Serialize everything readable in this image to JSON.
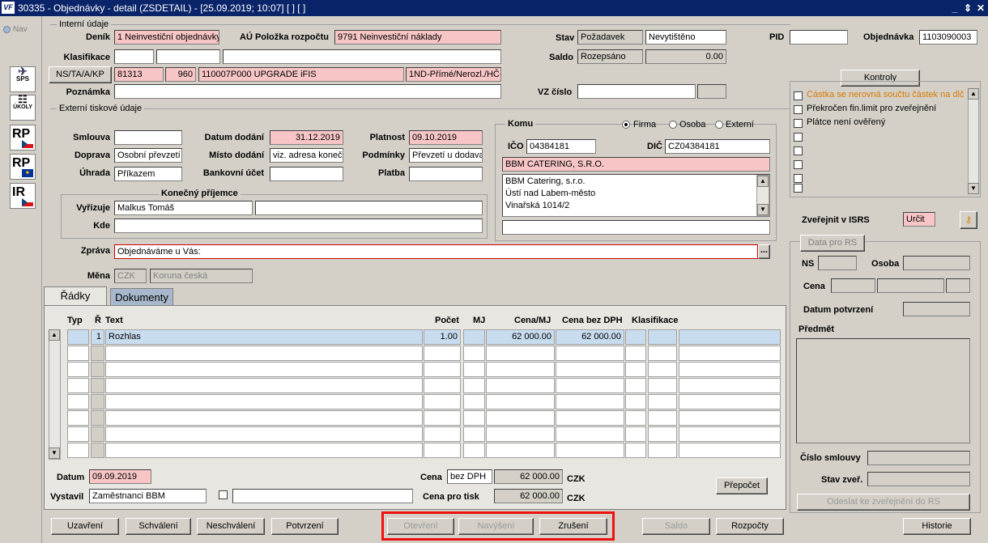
{
  "window": {
    "title": "30335 - Objednávky - detail (ZSDETAIL) - [25.09.2019; 10:07]  [ ]  [ ]",
    "logo": "VF",
    "buttons": [
      "_",
      "⇕",
      "✕"
    ]
  },
  "nav": {
    "label": "Nav"
  },
  "side": [
    {
      "label": "SPS"
    },
    {
      "label": "ÚKOLY"
    },
    {
      "label": "RP"
    },
    {
      "label": "RP"
    },
    {
      "label": "IR"
    }
  ],
  "interni": {
    "legend": "Interní údaje",
    "denik_label": "Deník",
    "denik": "1 Neinvestiční objednávky",
    "au_label": "AÚ Položka rozpočtu",
    "au": "9791 Neinvestiční náklady",
    "klasifikace_label": "Klasifikace",
    "ns_button": "NS/TA/A/KP",
    "ns1": "81313",
    "ns2": "960",
    "ns3": "110007P000 UPGRADE iFIS",
    "ns4": "1ND-Přímé/Nerozl./HČ-D",
    "poznamka_label": "Poznámka",
    "stav_label": "Stav",
    "stav1": "Požadavek",
    "stav2": "Nevytištěno",
    "saldo_label": "Saldo",
    "saldo1": "Rozepsáno",
    "saldo2": "0.00",
    "vz_label": "VZ číslo",
    "pid_label": "PID",
    "obj_label": "Objednávka",
    "obj": "1103090003"
  },
  "externi": {
    "legend": "Externí tiskové údaje",
    "smlouva_label": "Smlouva",
    "doprava_label": "Doprava",
    "doprava": "Osobní převzetí",
    "uhrada_label": "Úhrada",
    "uhrada": "Příkazem",
    "datum_dodani_label": "Datum dodání",
    "datum_dodani": "31.12.2019",
    "misto_label": "Místo dodání",
    "misto": "viz. adresa koneč",
    "bu_label": "Bankovní účet",
    "platnost_label": "Platnost",
    "platnost": "09.10.2019",
    "podminky_label": "Podmínky",
    "podminky": "Převzetí u dodava",
    "platba_label": "Platba"
  },
  "prijemce": {
    "legend": "Konečný příjemce",
    "vyrizuje_label": "Vyřizuje",
    "vyrizuje": "Malkus Tomáš",
    "kde_label": "Kde"
  },
  "zprava": {
    "label": "Zpráva",
    "value": "Objednáváme u Vás:",
    "more": "..."
  },
  "mena": {
    "label": "Měna",
    "code": "CZK",
    "name": "Koruna česká"
  },
  "komu": {
    "legend": "Komu",
    "radios": [
      "Firma",
      "Osoba",
      "Externí"
    ],
    "ico_label": "IČO",
    "ico": "04384181",
    "dic_label": "DIČ",
    "dic": "CZ04384181",
    "name": "BBM CATERING, S.R.O.",
    "address": [
      "BBM Catering, s.r.o.",
      "Ústí nad Labem-město",
      "Vinařská 1014/2"
    ]
  },
  "kontroly": {
    "button": "Kontroly",
    "items": [
      {
        "label": "Částka se nerovná součtu částek na dlč",
        "color": "#d97a00"
      },
      {
        "label": "Překročen fin.limit pro zveřejnění",
        "color": "#000000"
      },
      {
        "label": "Plátce není ověřený",
        "color": "#000000"
      }
    ]
  },
  "isrs": {
    "label": "Zveřejnit v ISRS",
    "value": "Určit"
  },
  "rs": {
    "button": "Data pro RS",
    "ns_label": "NS",
    "osoba_label": "Osoba",
    "cena_label": "Cena",
    "datum_label": "Datum potvrzení",
    "predmet_label": "Předmět",
    "cislo_label": "Číslo smlouvy",
    "stav_label": "Stav zveř.",
    "odeslat": "Odeslat ke zveřejnění do RS"
  },
  "tabs": [
    "Řádky",
    "Dokumenty"
  ],
  "grid": {
    "headers": [
      "Typ",
      "Ř",
      "Text",
      "Počet",
      "MJ",
      "Cena/MJ",
      "Cena bez DPH",
      "Klasifikace"
    ],
    "rows": [
      [
        "",
        "1",
        "Rozhlas",
        "1.00",
        "",
        "62 000.00",
        "62 000.00",
        "",
        "",
        ""
      ]
    ]
  },
  "footer": {
    "datum_label": "Datum",
    "datum": "09.09.2019",
    "vystavil_label": "Vystavil",
    "vystavil": "Zaměstnanci BBM",
    "cena_label": "Cena",
    "cena_typ": "bez DPH",
    "cena": "62 000.00",
    "mena": "CZK",
    "cena_tisk_label": "Cena pro tisk",
    "cena_tisk": "62 000.00",
    "prepocet": "Přepočet"
  },
  "buttons": {
    "uzavreni": "Uzavření",
    "schvaleni": "Schválení",
    "neschvaleni": "Neschválení",
    "potvrzeni": "Potvrzení",
    "otevreni": "Otevření",
    "navyseni": "Navýšení",
    "zruseni": "Zrušení",
    "saldo": "Saldo",
    "rozpocty": "Rozpočty",
    "historie": "Historie"
  },
  "colors": {
    "title_bg": "#0a246a",
    "pink": "#f7c5c5",
    "highlight": "#e11111",
    "selected_row": "#c8dcf0"
  }
}
